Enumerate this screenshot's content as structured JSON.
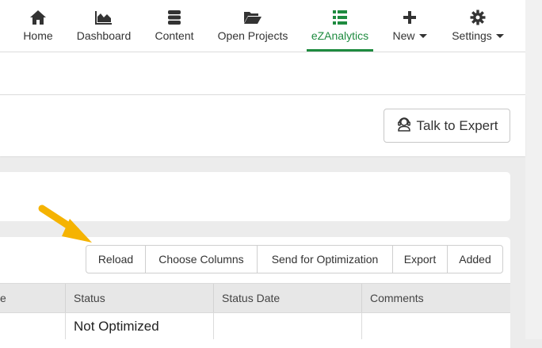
{
  "nav": {
    "items": [
      {
        "label": "Home",
        "icon": "home-icon",
        "has_caret": false
      },
      {
        "label": "Dashboard",
        "icon": "area-chart-icon",
        "has_caret": false
      },
      {
        "label": "Content",
        "icon": "database-icon",
        "has_caret": false
      },
      {
        "label": "Open Projects",
        "icon": "folder-open-icon",
        "has_caret": false
      },
      {
        "label": "eZAnalytics",
        "icon": "list-icon",
        "has_caret": false,
        "active": true
      },
      {
        "label": "New",
        "icon": "plus-icon",
        "has_caret": true
      },
      {
        "label": "Settings",
        "icon": "gear-icon",
        "has_caret": true
      }
    ],
    "active_color": "#1e8b3f"
  },
  "expert_button": {
    "label": "Talk to Expert",
    "icon": "headset-icon"
  },
  "toolbar": {
    "reload": "Reload",
    "choose_columns": "Choose Columns",
    "send_for_optimization": "Send for Optimization",
    "export": "Export",
    "added": "Added"
  },
  "table": {
    "headers": [
      "e",
      "Status",
      "Status Date",
      "Comments"
    ],
    "rows": [
      [
        "",
        "Not Optimized",
        "",
        ""
      ]
    ]
  },
  "annotation": {
    "arrow_color": "#f5b301"
  }
}
